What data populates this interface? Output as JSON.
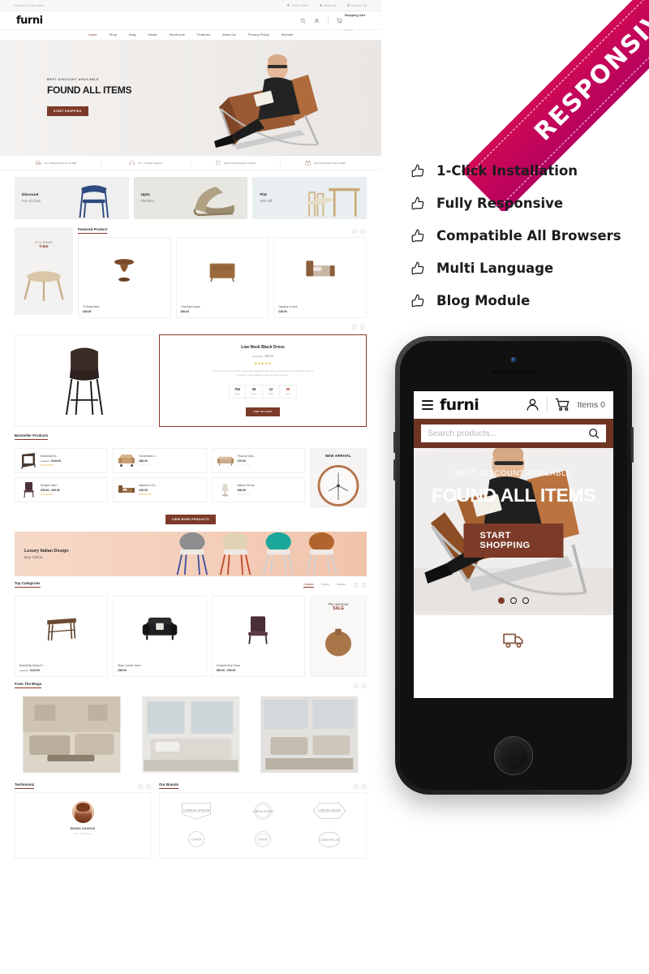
{
  "desktop": {
    "topbar": {
      "left_text": "Welcome to our store",
      "links": [
        {
          "label": "Track Order",
          "icon": "location-icon"
        },
        {
          "label": "About Us",
          "icon": "info-icon"
        },
        {
          "label": "Contact Us",
          "icon": "phone-icon"
        }
      ]
    },
    "header": {
      "logo": "furni",
      "cart_title": "Shopping Cart",
      "cart_sub": "Items 0",
      "icons": [
        "search-icon",
        "user-icon",
        "cart-icon"
      ]
    },
    "nav": [
      {
        "label": "Home",
        "active": true
      },
      {
        "label": "Shop",
        "active": false
      },
      {
        "label": "Blog",
        "active": false
      },
      {
        "label": "Media",
        "active": false
      },
      {
        "label": "ShortCode",
        "active": false
      },
      {
        "label": "Features",
        "active": false
      },
      {
        "label": "About Us",
        "active": false
      },
      {
        "label": "Privacy Policy",
        "active": false
      },
      {
        "label": "Wishlist",
        "active": false
      }
    ],
    "hero": {
      "eyebrow": "BEST DISCOUNT AVAILABLE",
      "title": "FOUND ALL ITEMS",
      "button": "START SHOPPING"
    },
    "services": [
      {
        "label": "Free Shipping Above On $99",
        "icon": "truck-icon"
      },
      {
        "label": "24 * 7 Online Support",
        "icon": "headset-icon"
      },
      {
        "label": "Return & Exchang In 3 Days",
        "icon": "refresh-icon"
      },
      {
        "label": "Special Weekly Offer & Gifts",
        "icon": "gift-icon"
      }
    ],
    "promos": [
      {
        "title": "Discount",
        "sub": "For All Chair"
      },
      {
        "title": "Upto",
        "sub": "Flat 50%"
      },
      {
        "title": "Flat",
        "sub": "45% Off"
      }
    ],
    "shop_time": {
      "line1": "IT'S SHOP",
      "line2": "TIME"
    },
    "featured": {
      "title": "Featured Product",
      "products": [
        {
          "name": "To Small Alesc",
          "price": "£85.00"
        },
        {
          "name": "Cras Eget Augue",
          "price": "£80.00"
        },
        {
          "name": "Dapibus In Scell",
          "price": "£35.00"
        }
      ]
    },
    "deal": {
      "title": "Low Nock Black Dress",
      "old_price": "£120.00",
      "price": "£90.00",
      "stars": "★★★★★",
      "description": "Lorem ipsum dolor sit amet consectetur adipiscing elit sed do eiusmod tempor incididunt ut labore et dolore magna aliqua ut enim ad minim veniam.",
      "countdown": [
        {
          "num": "754",
          "label": "Days"
        },
        {
          "num": "06",
          "label": "Hours"
        },
        {
          "num": "12",
          "label": "Mins"
        },
        {
          "num": "08",
          "label": "Secs"
        }
      ],
      "button": "ADD TO CART"
    },
    "bestseller": {
      "title": "Bestseller Products",
      "new_arrival_badge": "NEW ARRIVAL",
      "view_more": "VIEW MORE PRODUCTS",
      "products": [
        {
          "name": "Beautifully De...",
          "old": "£180.00",
          "price": "£140.00",
          "stars": "★★★★★",
          "rated": true
        },
        {
          "name": "Sinotivhable J...",
          "old": "",
          "price": "£88.00",
          "stars": "★★★★★",
          "rated": false
        },
        {
          "name": "Peacock Desi...",
          "old": "",
          "price": "£70.00",
          "stars": "★★★★★",
          "rated": false
        },
        {
          "name": "Designer Blue...",
          "old": "",
          "price": "£50.00 - £90.00",
          "stars": "★★★★★",
          "rated": true
        },
        {
          "name": "Dapibus In Sc...",
          "old": "",
          "price": "£35.00",
          "stars": "★★★★★",
          "rated": true
        },
        {
          "name": "Watson Shorty",
          "old": "",
          "price": "£96.00",
          "stars": "★★★★★",
          "rated": false
        }
      ]
    },
    "luxury": {
      "title": "Luxury Italian Design",
      "sub": "Buy Online"
    },
    "categories": {
      "title": "Top Categories",
      "tabs": [
        {
          "label": "Dresses",
          "active": true
        },
        {
          "label": "Gowns",
          "active": false
        },
        {
          "label": "Jackets",
          "active": false
        }
      ],
      "summer": {
        "line1": "The Summer",
        "line2": "SALE"
      },
      "products": [
        {
          "name": "Beautifully Design R...",
          "old": "£180.00",
          "price": "£140.00"
        },
        {
          "name": "Black Lowest Jeans",
          "old": "",
          "price": "£88.00"
        },
        {
          "name": "Designer Blue Dress",
          "old": "",
          "price": "£50.00 - £90.00"
        }
      ]
    },
    "blogs": {
      "title": "From The Blogs"
    },
    "testimonial": {
      "title": "Testimonial",
      "name": "REEMA GHUROE",
      "role": "UX / User Fanny"
    },
    "brands": {
      "title": "Our Brands",
      "items": [
        "LOREM IPSUM",
        "LOREM IPSUM",
        "LOREM IPSUM",
        "LOREM IPSUM",
        "LOREM IPSUM",
        "LOREM IPSUM"
      ]
    }
  },
  "ribbon": {
    "text": "RESPONSIVE",
    "color": "#c2004f"
  },
  "features": [
    {
      "label": "1-Click Installation",
      "icon": "thumbs-up-icon"
    },
    {
      "label": "Fully Responsive",
      "icon": "thumbs-up-icon"
    },
    {
      "label": "Compatible All Browsers",
      "icon": "thumbs-up-icon"
    },
    {
      "label": "Multi Language",
      "icon": "thumbs-up-icon"
    },
    {
      "label": "Blog Module",
      "icon": "thumbs-up-icon"
    }
  ],
  "mobile": {
    "logo": "furni",
    "cart_items": "Items 0",
    "search_placeholder": "Search products...",
    "hero": {
      "eyebrow": "BEST DISCOUNT AVAILABLE",
      "title": "FOUND ALL ITEMS",
      "button": "START SHOPPING"
    },
    "slider_dots": 3,
    "active_dot": 1
  }
}
